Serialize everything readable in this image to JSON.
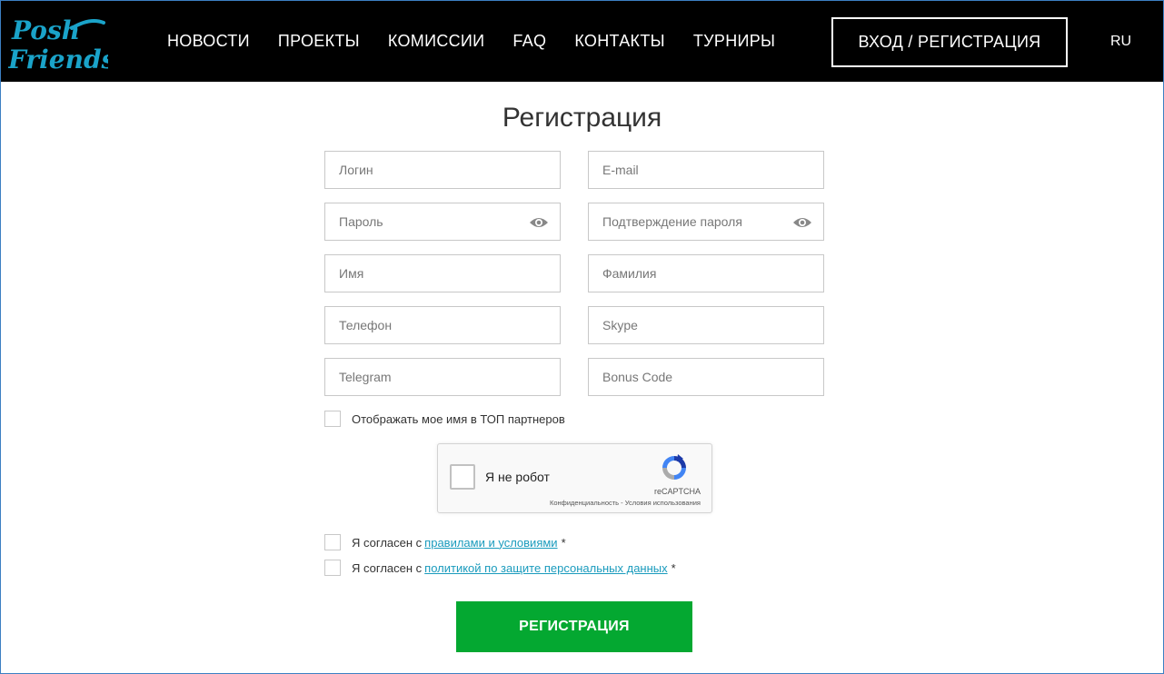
{
  "header": {
    "logo_alt": "Posh Friends",
    "nav": [
      "НОВОСТИ",
      "ПРОЕКТЫ",
      "КОМИССИИ",
      "FAQ",
      "КОНТАКТЫ",
      "ТУРНИРЫ"
    ],
    "login_label": "ВХОД / РЕГИСТРАЦИЯ",
    "lang": "RU"
  },
  "form": {
    "title": "Регистрация",
    "fields": {
      "login": "Логин",
      "email": "E-mail",
      "password": "Пароль",
      "password_confirm": "Подтверждение пароля",
      "first_name": "Имя",
      "last_name": "Фамилия",
      "phone": "Телефон",
      "skype": "Skype",
      "telegram": "Telegram",
      "bonus_code": "Bonus Code"
    },
    "show_in_top": "Отображать мое имя в ТОП партнеров",
    "recaptcha": {
      "label": "Я не робот",
      "brand": "reCAPTCHA",
      "privacy": "Конфиденциальность",
      "separator": " - ",
      "terms": "Условия использования"
    },
    "agree_rules_prefix": "Я согласен с",
    "agree_rules_link": "правилами и условиями",
    "agree_privacy_prefix": "Я согласен с",
    "agree_privacy_link": "политикой по защите персональных данных",
    "required_mark": "*",
    "submit_label": "РЕГИСТРАЦИЯ"
  },
  "colors": {
    "header_bg": "#000000",
    "logo": "#1aa3c9",
    "link": "#1a9bbd",
    "submit": "#04a831"
  },
  "icons": {
    "password_toggle": "eye-icon",
    "captcha": "recaptcha-logo-icon"
  }
}
